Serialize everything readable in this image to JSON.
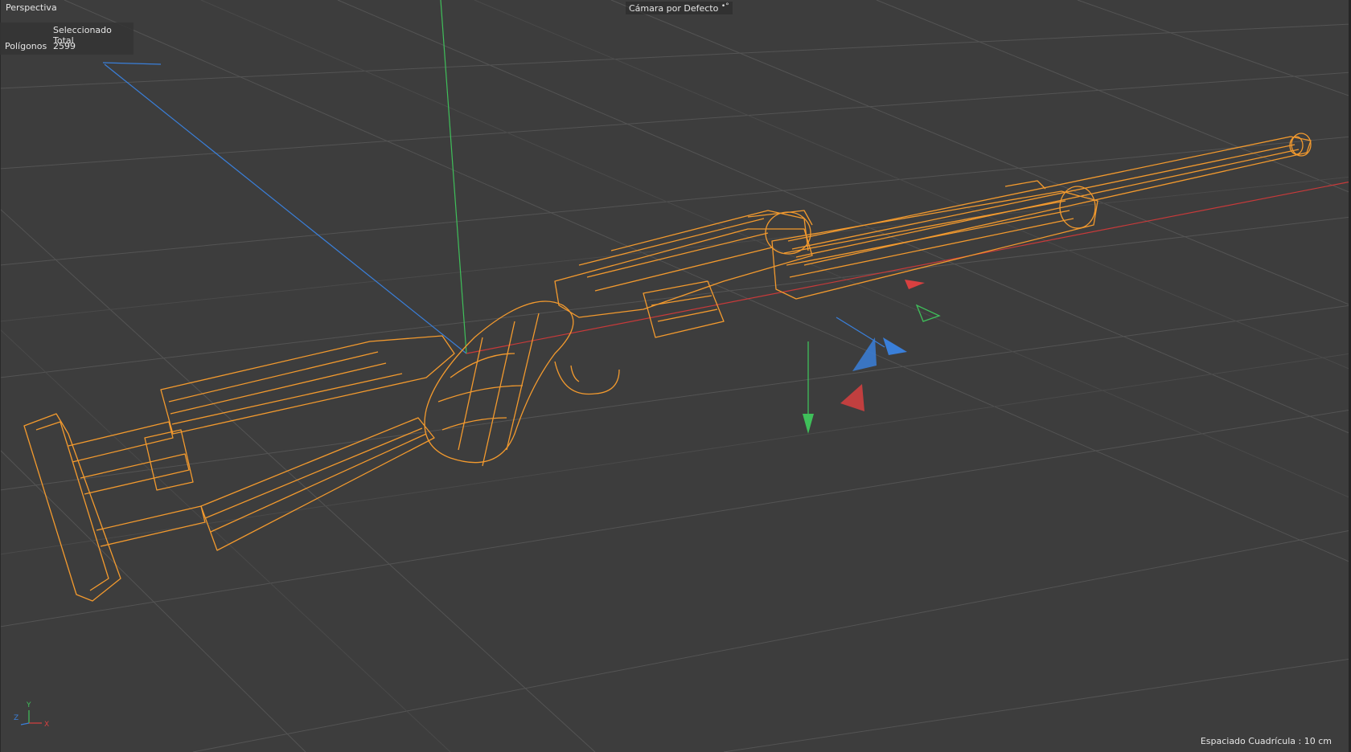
{
  "viewport": {
    "view_name": "Perspectiva",
    "camera_name": "Cámara por Defecto",
    "camera_icon": "camera-dots-icon"
  },
  "stats": {
    "header": "Seleccionado Total",
    "label": "Polígonos",
    "value": "2599"
  },
  "footer": {
    "grid_spacing": "Espaciado Cuadrícula : 10 cm"
  },
  "axis_widget": {
    "x_label": "X",
    "y_label": "Y",
    "z_label": "Z"
  },
  "colors": {
    "background": "#3d3d3d",
    "grid_line": "#555555",
    "wireframe": "#f39a2e",
    "axis_x": "#d84040",
    "axis_y": "#3fbf5a",
    "axis_z": "#3a7fd9"
  }
}
